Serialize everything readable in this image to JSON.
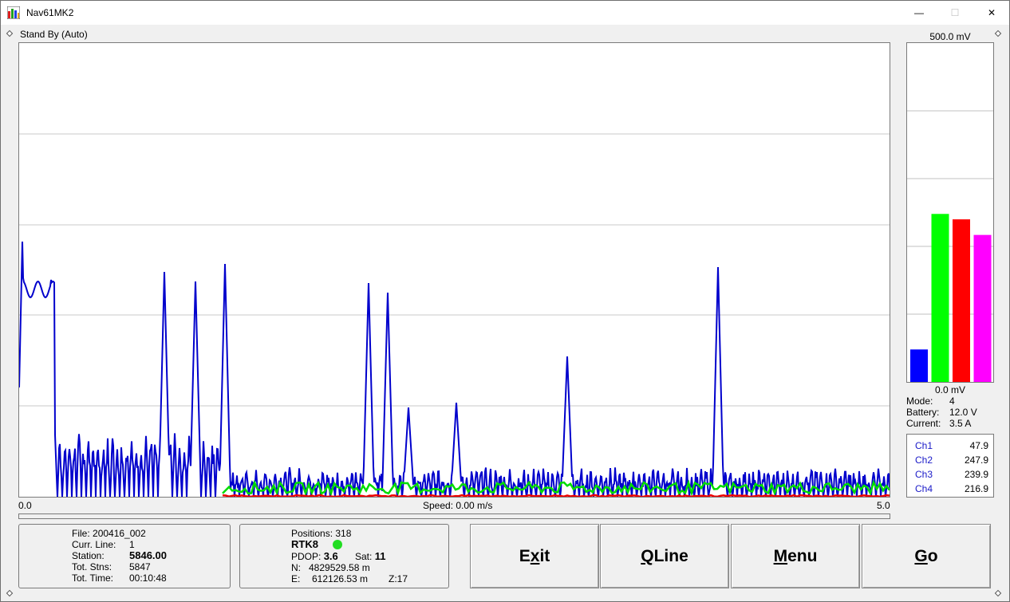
{
  "window": {
    "title": "Nav61MK2",
    "minimize_glyph": "—",
    "maximize_glyph": "☐",
    "close_glyph": "✕"
  },
  "status": "Stand By (Auto)",
  "plot": {
    "x_min_label": "0.0",
    "x_max_label": "5.0",
    "speed_label": "Speed:  0.00 m/s"
  },
  "meter": {
    "top_label": "500.0 mV",
    "bottom_label": "0.0 mV",
    "bars": [
      {
        "name": "Ch1",
        "value": 47.9,
        "color": "#0000ff"
      },
      {
        "name": "Ch2",
        "value": 247.9,
        "color": "#00ff00"
      },
      {
        "name": "Ch3",
        "value": 239.9,
        "color": "#ff0000"
      },
      {
        "name": "Ch4",
        "value": 216.9,
        "color": "#ff00ff"
      }
    ],
    "max_value": 500
  },
  "device": {
    "mode_label": "Mode:",
    "mode_value": "4",
    "battery_label": "Battery:",
    "battery_value": "12.0 V",
    "current_label": "Current:",
    "current_value": "3.5 A"
  },
  "channels": [
    {
      "name": "Ch1",
      "value": "47.9"
    },
    {
      "name": "Ch2",
      "value": "247.9"
    },
    {
      "name": "Ch3",
      "value": "239.9"
    },
    {
      "name": "Ch4",
      "value": "216.9"
    }
  ],
  "file_panel": {
    "file_label": "File:",
    "file_value": "200416_002",
    "curr_line_label": "Curr. Line:",
    "curr_line_value": "1",
    "station_label": "Station:",
    "station_value": "5846.00",
    "tot_stns_label": "Tot. Stns:",
    "tot_stns_value": "5847",
    "tot_time_label": "Tot. Time:",
    "tot_time_value": "00:10:48"
  },
  "gps_panel": {
    "positions_label": "Positions:",
    "positions_value": "318",
    "fix": "RTK8",
    "fix_color": "#22dd22",
    "pdop_label": "PDOP:",
    "pdop_value": "3.6",
    "sat_label": "Sat:",
    "sat_value": "11",
    "n_label": "N:",
    "n_value": "4829529.58 m",
    "e_label": "E:",
    "e_value": "612126.53 m",
    "zone": "Z:17"
  },
  "buttons": {
    "exit": {
      "pre": "E",
      "u": "x",
      "post": "it"
    },
    "qline": {
      "pre": "",
      "u": "Q",
      "post": "Line"
    },
    "menu": {
      "pre": "",
      "u": "M",
      "post": "enu"
    },
    "go": {
      "pre": "",
      "u": "G",
      "post": "o"
    }
  }
}
